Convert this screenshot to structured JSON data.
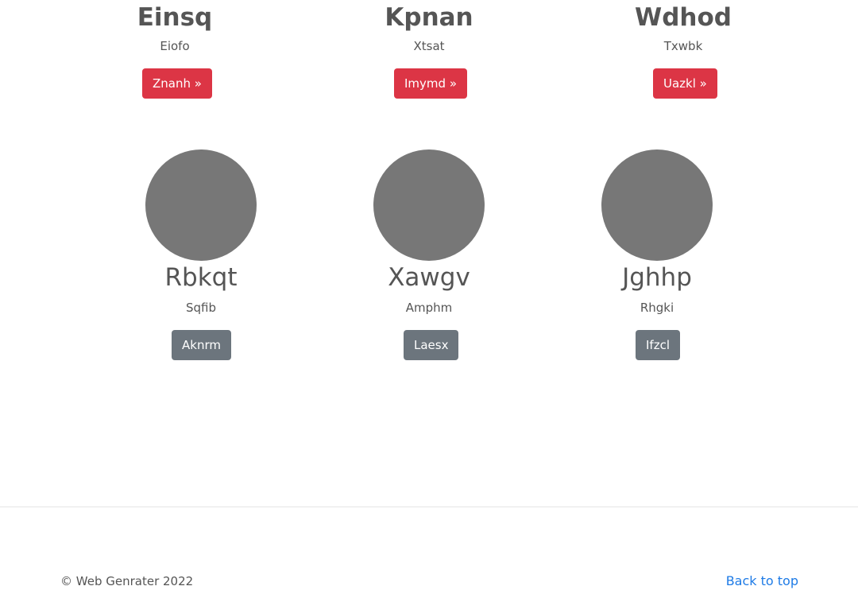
{
  "features": [
    {
      "title": "Einsq",
      "text": "Eiofo",
      "button": "Znanh »"
    },
    {
      "title": "Kpnan",
      "text": "Xtsat",
      "button": "Imymd »"
    },
    {
      "title": "Wdhod",
      "text": "Txwbk",
      "button": "Uazkl »"
    }
  ],
  "members": [
    {
      "name": "Rbkqt",
      "text": "Sqfib",
      "button": "Aknrm"
    },
    {
      "name": "Xawgv",
      "text": "Amphm",
      "button": "Laesx"
    },
    {
      "name": "Jghhp",
      "text": "Rhgki",
      "button": "Ifzcl"
    }
  ],
  "footer": {
    "copyright": "© Web Genrater 2022",
    "back_to_top": "Back to top"
  },
  "colors": {
    "primary_button": "#dc3545",
    "secondary_button": "#6c757d",
    "avatar_placeholder": "#777777",
    "link": "#1e7be6"
  }
}
